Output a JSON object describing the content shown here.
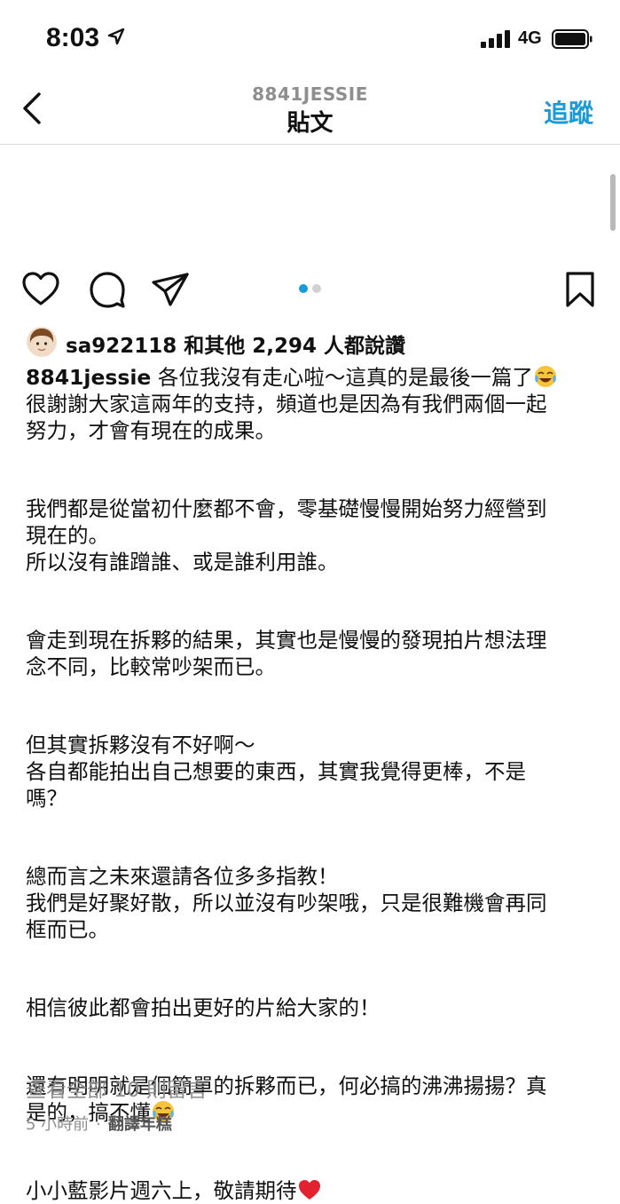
{
  "status_bar": {
    "time": "8:03",
    "network": "4G"
  },
  "header": {
    "username": "8841JESSIE",
    "title": "貼文",
    "follow_label": "追蹤"
  },
  "carousel": {
    "current_index": 1,
    "total": 2
  },
  "likes": {
    "text": "sa922118 和其他 2,294 人都說讚"
  },
  "caption": {
    "username": "8841jessie",
    "line1_text": " 各位我沒有走心啦～這真的是最後一篇了",
    "line2": "很謝謝大家這兩年的支持，頻道也是因為有我們兩個一起",
    "line3": "努力，才會有現在的成果。",
    "line4": "我們都是從當初什麼都不會，零基礎慢慢開始努力經營到",
    "line5": "現在的。",
    "line6": "所以沒有誰蹭誰、或是誰利用誰。",
    "line7": "會走到現在拆夥的結果，其實也是慢慢的發現拍片想法理",
    "line8": "念不同，比較常吵架而已。",
    "line9": "但其實拆夥沒有不好啊～",
    "line10": "各自都能拍出自己想要的東西，其實我覺得更棒，不是",
    "line11": "嗎？",
    "line12": "總而言之未來還請各位多多指教！",
    "line13": "我們是好聚好散，所以並沒有吵架哦，只是很難機會再同",
    "line14": "框而已。",
    "line15": "相信彼此都會拍出更好的片給大家的！",
    "line16": "還有明明就是個簡單的拆夥而已，何必搞的沸沸揚揚？真",
    "line17": "是的，搞不懂",
    "line18": "小小藍影片週六上，敬請期待"
  },
  "view_comments": "查看全部 10 則留言",
  "meta": {
    "time_ago": "5 小時前",
    "separator": "·",
    "translate": "翻譯年糕"
  },
  "colors": {
    "accent": "#1a9bd7",
    "muted_text": "#8e8e8e",
    "active_dot": "#1a9bd7",
    "inactive_dot": "#d0d0d0"
  }
}
